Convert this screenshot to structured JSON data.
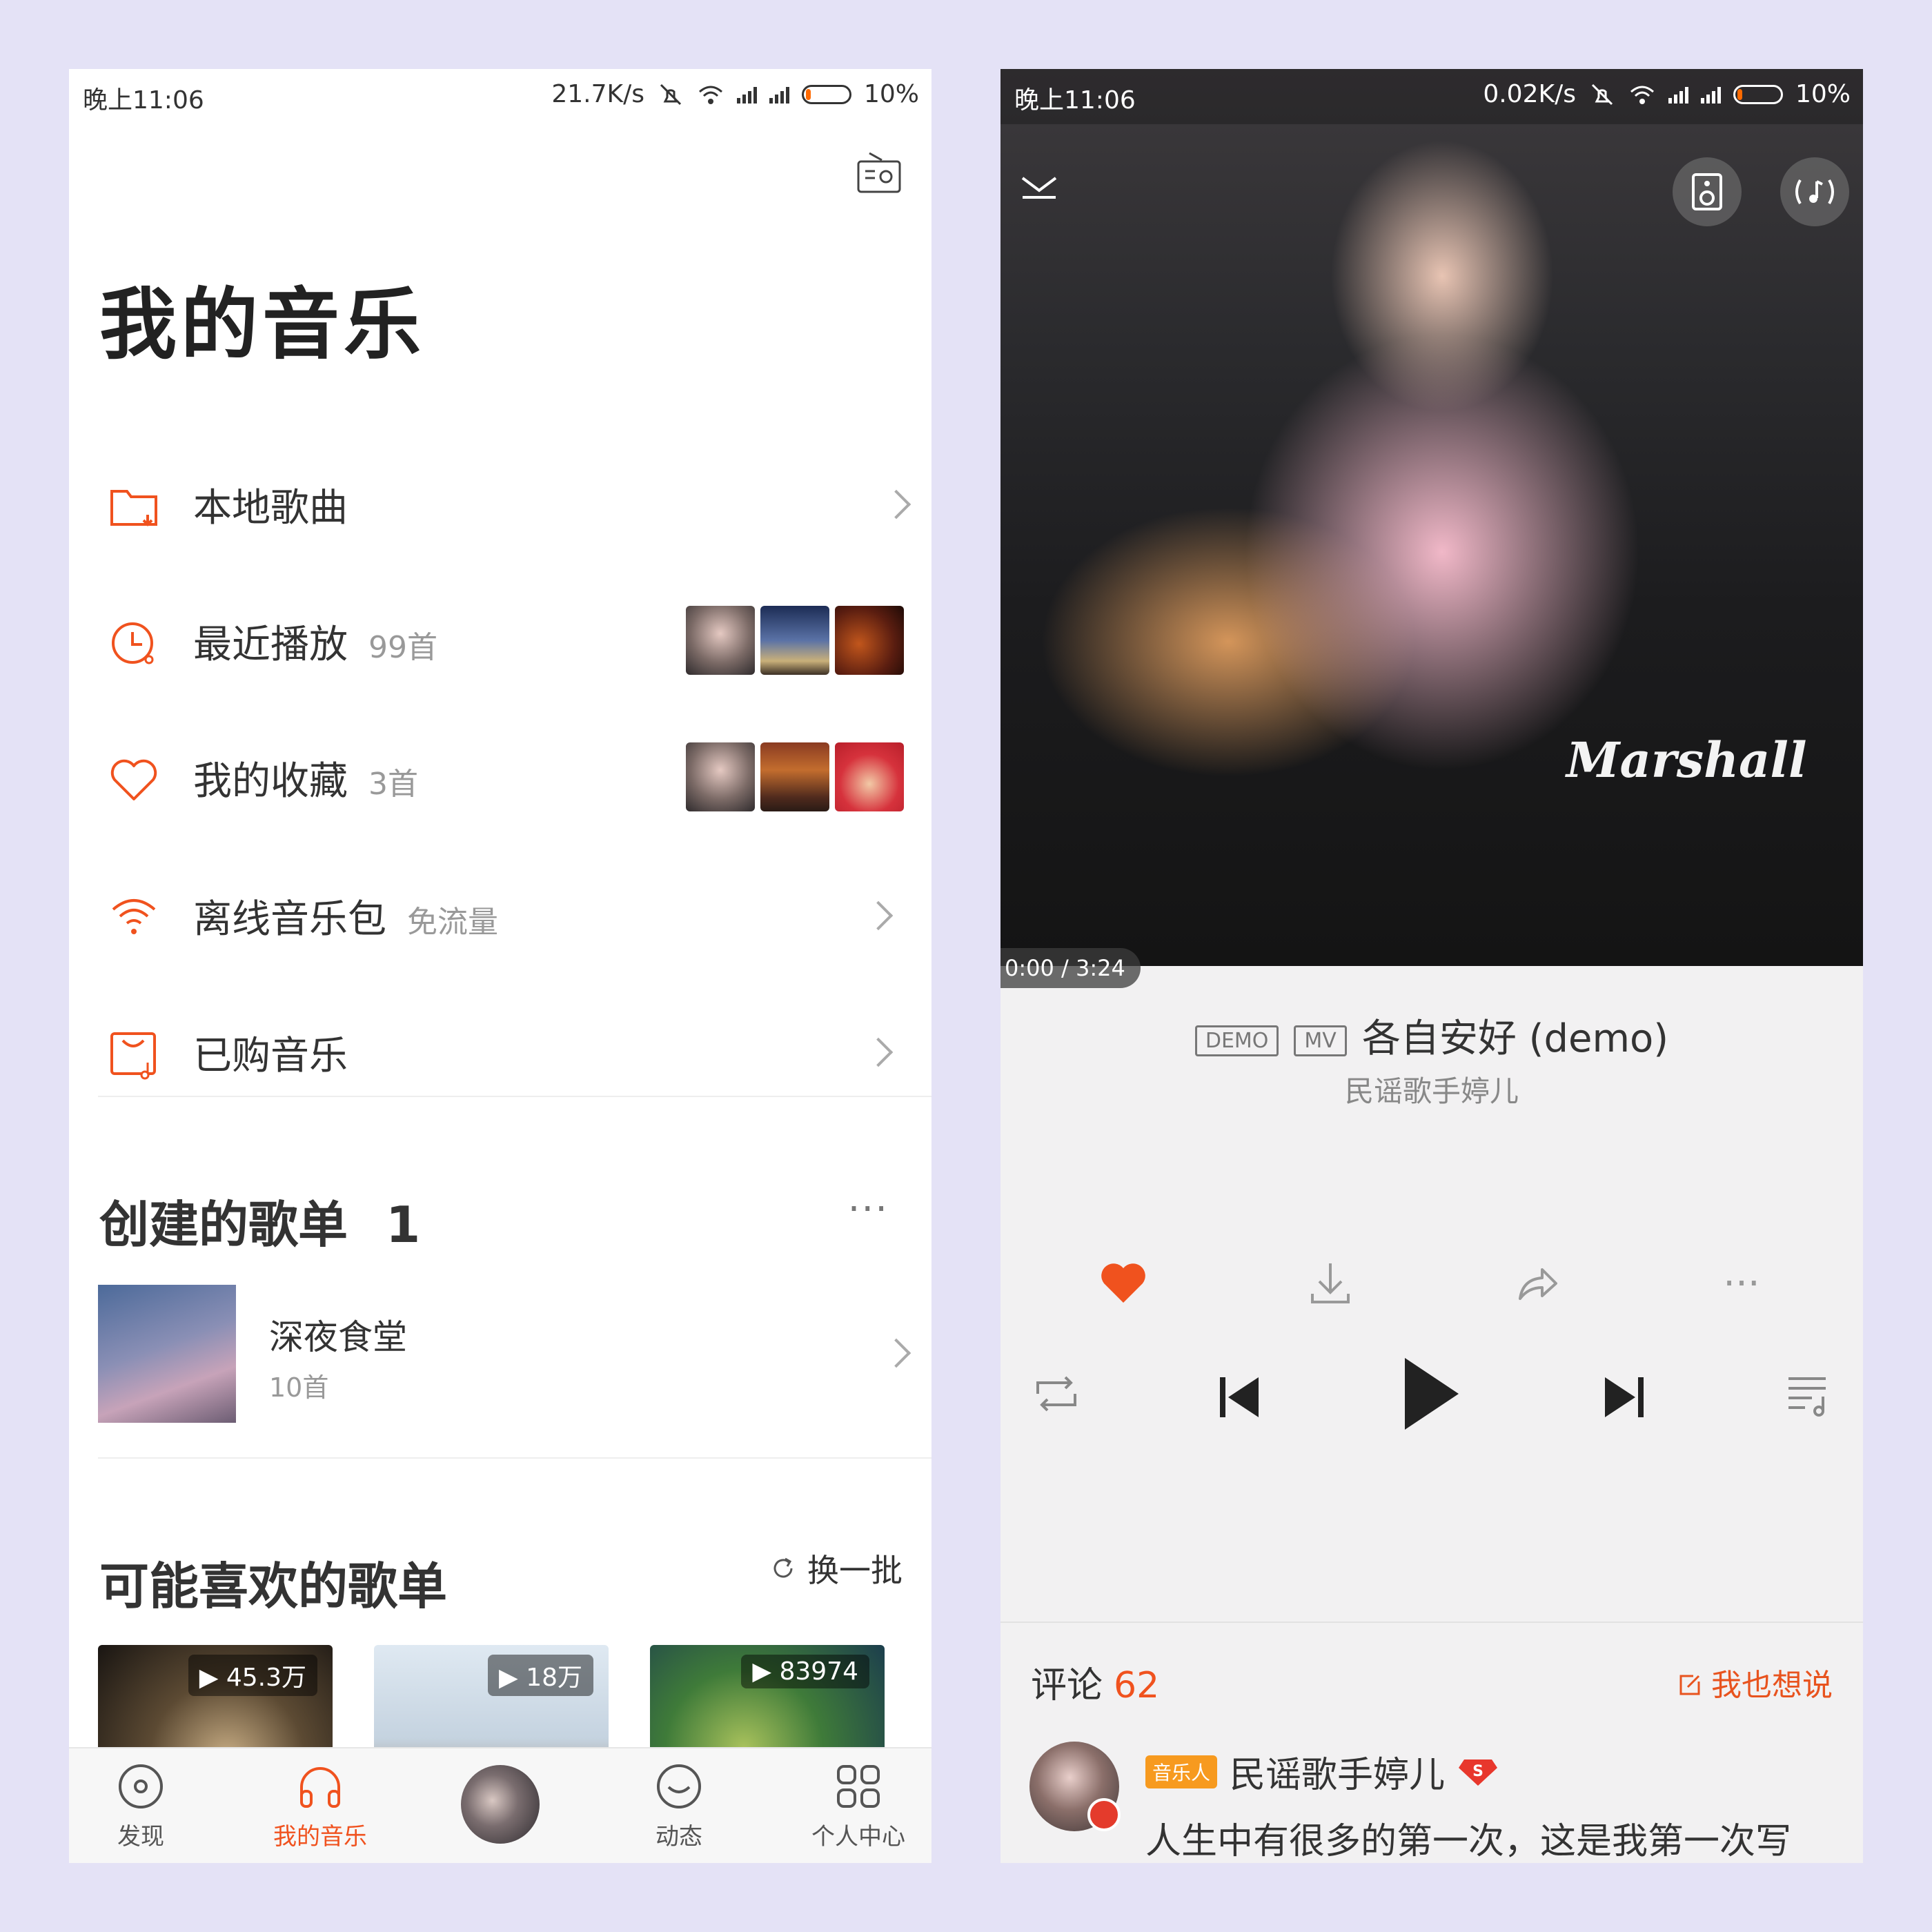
{
  "left": {
    "status": {
      "time": "晚上11:06",
      "speed": "21.7K/s",
      "battery": "10%"
    },
    "title": "我的音乐",
    "menu": [
      {
        "label": "本地歌曲",
        "count": ""
      },
      {
        "label": "最近播放",
        "count": "99首"
      },
      {
        "label": "我的收藏",
        "count": "3首"
      },
      {
        "label": "离线音乐包",
        "count": "免流量"
      },
      {
        "label": "已购音乐",
        "count": ""
      }
    ],
    "created": {
      "title": "创建的歌单",
      "count": "1",
      "playlist": {
        "name": "深夜食堂",
        "count": "10首"
      }
    },
    "recommend": {
      "title": "可能喜欢的歌单",
      "refresh": "换一批",
      "cards": [
        {
          "plays": "45.3万"
        },
        {
          "plays": "18万"
        },
        {
          "plays": "83974"
        }
      ]
    },
    "tabs": [
      {
        "label": "发现"
      },
      {
        "label": "我的音乐"
      },
      {
        "label": "动态"
      },
      {
        "label": "个人中心"
      }
    ],
    "accent": "#f0521e"
  },
  "right": {
    "status": {
      "time": "晚上11:06",
      "speed": "0.02K/s",
      "battery": "10%"
    },
    "photo_text": "Marshall",
    "time": "0:00 / 3:24",
    "tags": [
      "DEMO",
      "MV"
    ],
    "song": "各自安好 (demo)",
    "artist": "民谣歌手婷儿",
    "comments": {
      "label": "评论",
      "count": "62",
      "write": "我也想说",
      "user_tag": "音乐人",
      "user": "民谣歌手婷儿",
      "text": "人生中有很多的第一次，这是我第一次写"
    }
  }
}
